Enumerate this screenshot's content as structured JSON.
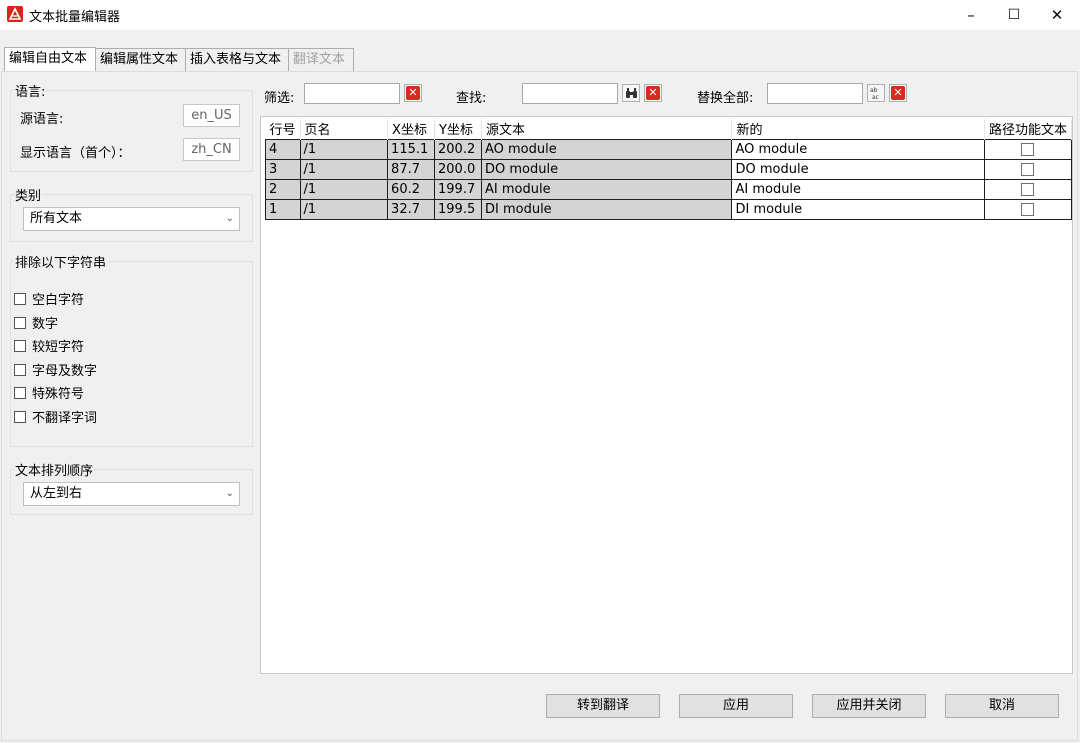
{
  "window": {
    "title": "文本批量编辑器",
    "minimize": "–",
    "maximize": "☐",
    "close": "✕",
    "brand_color": "#d9251c"
  },
  "tabs": [
    {
      "label": "编辑自由文本",
      "state": "active"
    },
    {
      "label": "编辑属性文本",
      "state": "normal"
    },
    {
      "label": "插入表格与文本",
      "state": "normal"
    },
    {
      "label": "翻译文本",
      "state": "disabled"
    }
  ],
  "language": {
    "group_title": "语言:",
    "source_label": "源语言:",
    "source_value": "en_US",
    "display_label": "显示语言（首个）：",
    "display_value": "zh_CN"
  },
  "category": {
    "group_title": "类别",
    "selected": "所有文本"
  },
  "exclude": {
    "group_title": "排除以下字符串",
    "options": [
      {
        "label": "空白字符",
        "checked": false
      },
      {
        "label": "数字",
        "checked": false
      },
      {
        "label": "较短字符",
        "checked": false
      },
      {
        "label": "字母及数字",
        "checked": false
      },
      {
        "label": "特殊符号",
        "checked": false
      },
      {
        "label": "不翻译字词",
        "checked": false
      }
    ]
  },
  "sort": {
    "group_title": "文本排列顺序",
    "selected": "从左到右"
  },
  "toolbar": {
    "filter_label": "筛选:",
    "filter_value": "",
    "find_label": "查找:",
    "find_value": "",
    "replace_label": "替换全部:",
    "replace_value": "",
    "clear_icon": "clear-x-icon",
    "find_icon": "binoculars-icon",
    "replace_icon": "replace-ab-ac-icon"
  },
  "table": {
    "columns": [
      "行号",
      "页名",
      "X坐标",
      "Y坐标",
      "源文本",
      "新的",
      "路径功能文本"
    ],
    "rows": [
      {
        "row": "4",
        "page": "/1",
        "x": "115.1",
        "y": "200.2",
        "source": "AO module",
        "new": "AO module",
        "path": false
      },
      {
        "row": "3",
        "page": "/1",
        "x": "87.7",
        "y": "200.0",
        "source": "DO module",
        "new": "DO module",
        "path": false
      },
      {
        "row": "2",
        "page": "/1",
        "x": "60.2",
        "y": "199.7",
        "source": "AI module",
        "new": "AI module",
        "path": false
      },
      {
        "row": "1",
        "page": "/1",
        "x": "32.7",
        "y": "199.5",
        "source": "DI module",
        "new": "DI module",
        "path": false
      }
    ]
  },
  "buttons": {
    "goto_translate": "转到翻译",
    "apply": "应用",
    "apply_close": "应用并关闭",
    "cancel": "取消"
  }
}
